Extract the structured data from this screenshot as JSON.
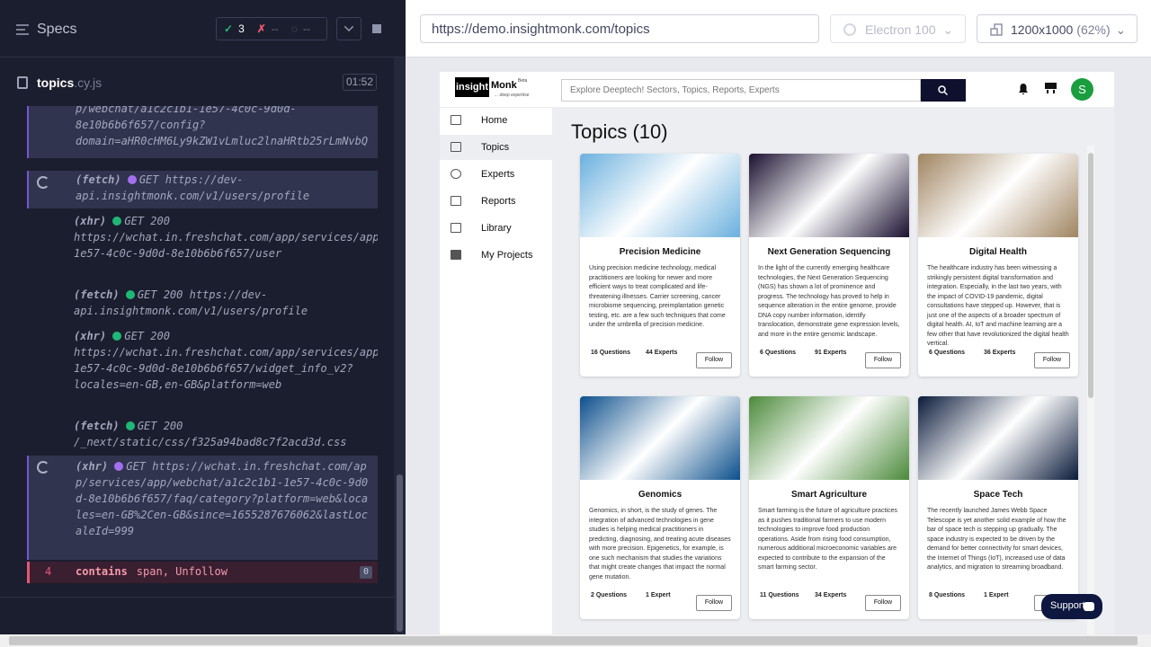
{
  "runner": {
    "specs_title": "Specs",
    "stats": {
      "passed": "3",
      "failed": "--",
      "pending": "--"
    },
    "file_name": "topics",
    "file_ext": ".cy.js",
    "duration": "01:52",
    "commands": [
      {
        "type": "",
        "method": "",
        "text": "p/webchat/a1c2c1b1-1e57-4c0c-9d0d-8e10b6b6f657/config?domain=aHR0cHM6Ly9kZW1vLmluc2lnaHRtb25rLmNvbQ",
        "state": "pending"
      },
      {
        "type": "(fetch)",
        "method": "GET",
        "text": "https://dev-api.insightmonk.com/v1/users/profile",
        "state": "pending"
      },
      {
        "type": "(xhr)",
        "method": "GET 200",
        "text": "https://wchat.in.freshchat.com/app/services/app/webchat/a1c2c1b1-1e57-4c0c-9d0d-8e10b6b6f657/user",
        "state": "done"
      },
      {
        "type": "(fetch)",
        "method": "GET 200",
        "text": "https://dev-api.insightmonk.com/v1/users/profile",
        "state": "done"
      },
      {
        "type": "(xhr)",
        "method": "GET 200",
        "text": "https://wchat.in.freshchat.com/app/services/app/webchat/a1c2c1b1-1e57-4c0c-9d0d-8e10b6b6f657/widget_info_v2?locales=en-GB,en-GB&platform=web",
        "state": "done"
      },
      {
        "type": "(fetch)",
        "method": "GET 200",
        "text": "/_next/static/css/f325a94bad8c7f2acd3d.css",
        "state": "done"
      },
      {
        "type": "(xhr)",
        "method": "GET",
        "text": "https://wchat.in.freshchat.com/app/services/app/webchat/a1c2c1b1-1e57-4c0c-9d0d-8e10b6b6f657/faq/category?platform=web&locales=en-GB%2Cen-GB&since=1655287676062&lastLocaleId=999",
        "state": "pending"
      }
    ],
    "failed_cmd": {
      "num": "4",
      "name": "contains",
      "args": "span, Unfollow",
      "count": "0"
    }
  },
  "browser": {
    "url": "https://demo.insightmonk.com/topics",
    "engine": "Electron 100",
    "viewport": "1200x1000",
    "scale": "(62%)"
  },
  "app": {
    "logo_box": "insight",
    "logo_txt": "Monk",
    "logo_beta": "Beta",
    "logo_tag": "... deep expertise",
    "search_placeholder": "Explore Deeptech! Sectors, Topics,  Reports, Experts",
    "avatar": "S",
    "nav": [
      "Home",
      "Topics",
      "Experts",
      "Reports",
      "Library",
      "My Projects"
    ],
    "page_title": "Topics (10)",
    "support": "Support",
    "follow_label": "Follow",
    "cards": [
      {
        "title": "Precision Medicine",
        "desc": "Using precision medicine technology, medical practitioners are looking for newer and more efficient ways to treat complicated and life-threatening illnesses. Carrier screening, cancer microbiome sequencing, preimplantation genetic testing, etc. are a few such techniques that come under the umbrella of precision medicine.",
        "questions": "16 Questions",
        "experts": "44 Experts",
        "img_color": "#6ab0de"
      },
      {
        "title": "Next Generation Sequencing",
        "desc": "In the light of the currently emerging healthcare technologies, the Next Generation Sequencing (NGS) has shown a lot of prominence and progress. The technology has proved to help in sequence alteration in the entire genome, provide DNA copy number information, identify translocation, demonstrate gene expression levels, and more in the entire genomic landscape.",
        "questions": "6 Questions",
        "experts": "91 Experts",
        "img_color": "#1a1030"
      },
      {
        "title": "Digital Health",
        "desc": "The healthcare industry has been witnessing a strikingly persistent digital transformation and integration. Especially, in the last two years, with the impact of COVID-19 pandemic, digital consultations have stepped up. However, that is just one of the aspects of a broader spectrum of digital health. AI, IoT and machine learning are a few other that have revolutionized the digital health vertical.",
        "questions": "6 Questions",
        "experts": "36 Experts",
        "img_color": "#a08460"
      },
      {
        "title": "Genomics",
        "desc": "Genomics, in short, is the study of genes. The integration of advanced technologies in gene studies is helping medical practitioners in predicting, diagnosing, and treating acute diseases with more precision. Epigenetics, for example, is one such mechanism that studies the variations that might create changes that impact the normal gene mutation.",
        "questions": "2 Questions",
        "experts": "1 Expert",
        "img_color": "#0c4f8c"
      },
      {
        "title": "Smart Agriculture",
        "desc": "Smart farming is the future of agriculture practices as it pushes traditional farmers to use modern technologies to improve food production operations. Aside from rising food consumption, numerous additional microeconomic variables are expected to contribute to the expansion of the smart farming sector.",
        "questions": "11 Questions",
        "experts": "34 Experts",
        "img_color": "#4b8a3a"
      },
      {
        "title": "Space Tech",
        "desc": "The recently launched James Webb Space Telescope is yet another solid example of how the bar of space tech is stepping up gradually. The space industry is expected to be driven by the demand for better connectivity for smart devices, the Internet of Things (IoT), increased use of data analytics, and migration to streaming broadband.",
        "questions": "8 Questions",
        "experts": "1 Expert",
        "img_color": "#0a1a3a"
      }
    ]
  }
}
